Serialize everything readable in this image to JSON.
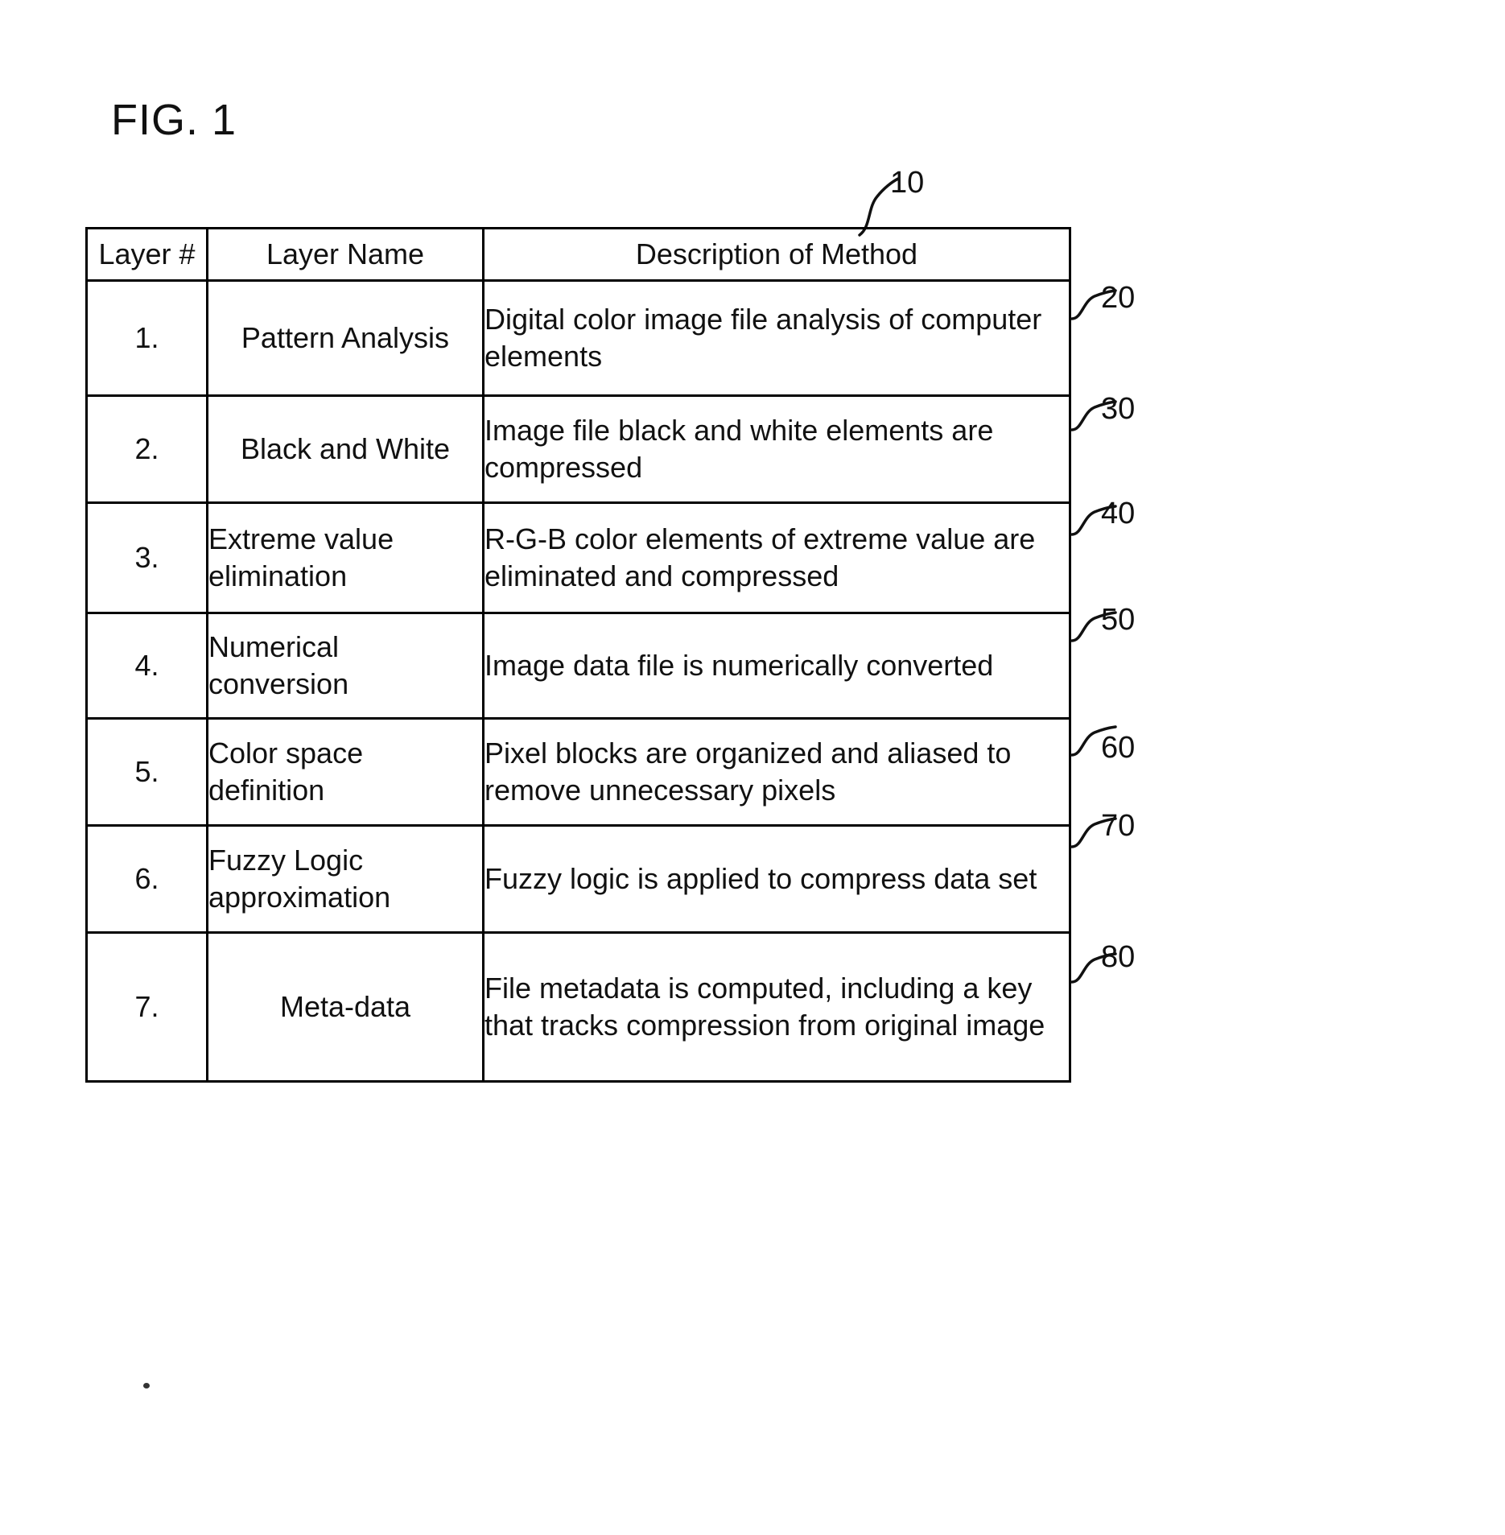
{
  "figure": {
    "title": "FIG. 1",
    "main_callout": "10"
  },
  "table": {
    "headers": [
      "Layer #",
      "Layer Name",
      "Description of Method"
    ],
    "rows": [
      {
        "number": "1.",
        "name": "Pattern Analysis",
        "description": "Digital color image file analysis of computer elements",
        "callout": "20"
      },
      {
        "number": "2.",
        "name": "Black and White",
        "description": "Image file black and white elements are compressed",
        "callout": "30"
      },
      {
        "number": "3.",
        "name": "Extreme value elimination",
        "description": "R-G-B color elements of extreme value are eliminated and compressed",
        "callout": "40"
      },
      {
        "number": "4.",
        "name": "Numerical conversion",
        "description": "Image data file is numerically converted",
        "callout": "50"
      },
      {
        "number": "5.",
        "name": "Color space definition",
        "description": "Pixel blocks are organized and aliased to remove unnecessary pixels",
        "callout": "60"
      },
      {
        "number": "6.",
        "name": "Fuzzy Logic approximation",
        "description": "Fuzzy logic is applied to compress data set",
        "callout": "70"
      },
      {
        "number": "7.",
        "name": "Meta-data",
        "description": "File metadata is computed, including a key that tracks compression from original image",
        "callout": "80"
      }
    ]
  }
}
